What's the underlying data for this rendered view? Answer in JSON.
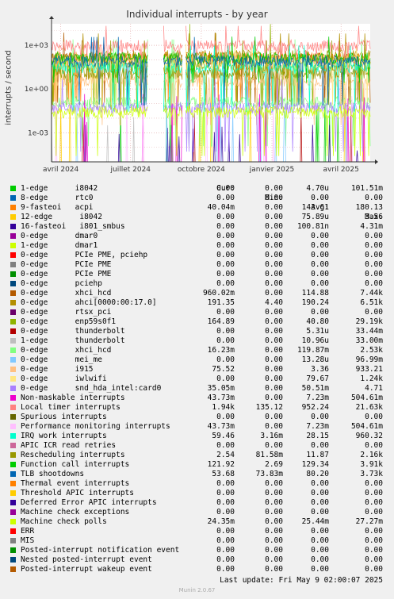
{
  "title": "Individual interrupts - by year",
  "vendor": "RRDTOOL / TOBI OETIKER",
  "footer": {
    "last_update": "Last update: Fri May  9 02:00:07 2025",
    "munin": "Munin 2.0.67"
  },
  "columns": [
    "Cur:",
    "Min:",
    "Avg:",
    "Max:"
  ],
  "chart_data": {
    "type": "line",
    "title": "Individual interrupts - by year",
    "ylabel": "interrupts / second",
    "yscale": "log",
    "ylim": [
      1e-05,
      30000
    ],
    "y_ticks": [
      0.001,
      1,
      1000
    ],
    "y_tick_labels": [
      "1e-03",
      "1e+00",
      "1e+03"
    ],
    "xlim": [
      "2024-03-20",
      "2025-05-09"
    ],
    "x_ticks": [
      "2024-04-01",
      "2024-07-01",
      "2024-10-01",
      "2025-01-01",
      "2025-04-01"
    ],
    "x_tick_labels": [
      "avril 2024",
      "juillet 2024",
      "octobre 2024",
      "janvier 2025",
      "avril 2025"
    ],
    "data_gaps": [
      [
        "2024-07-24",
        "2024-08-12"
      ],
      [
        "2024-09-07",
        "2024-09-10"
      ]
    ],
    "grid": true,
    "series": [
      {
        "name": "1-edge      i8042",
        "color": "#00cc00",
        "cur": "0.00",
        "min": "0.00",
        "avg": "4.70u",
        "max": "101.51m"
      },
      {
        "name": "8-edge      rtc0",
        "color": "#0066b3",
        "cur": "0.00",
        "min": "0.00",
        "avg": "0.00",
        "max": "0.00"
      },
      {
        "name": "9-fasteoi   acpi",
        "color": "#ff8000",
        "cur": "40.04m",
        "min": "0.00",
        "avg": "143.61",
        "max": "180.13"
      },
      {
        "name": "12-edge      i8042",
        "color": "#ffcc00",
        "cur": "0.00",
        "min": "0.00",
        "avg": "75.89u",
        "max": "3.56"
      },
      {
        "name": "16-fasteoi   i801_smbus",
        "color": "#330099",
        "cur": "0.00",
        "min": "0.00",
        "avg": "100.81n",
        "max": "4.31m"
      },
      {
        "name": "0-edge      dmar0",
        "color": "#990099",
        "cur": "0.00",
        "min": "0.00",
        "avg": "0.00",
        "max": "0.00"
      },
      {
        "name": "1-edge      dmar1",
        "color": "#ccff00",
        "cur": "0.00",
        "min": "0.00",
        "avg": "0.00",
        "max": "0.00"
      },
      {
        "name": "0-edge      PCIe PME, pciehp",
        "color": "#ff0000",
        "cur": "0.00",
        "min": "0.00",
        "avg": "0.00",
        "max": "0.00"
      },
      {
        "name": "0-edge      PCIe PME",
        "color": "#808080",
        "cur": "0.00",
        "min": "0.00",
        "avg": "0.00",
        "max": "0.00"
      },
      {
        "name": "0-edge      PCIe PME",
        "color": "#008f00",
        "cur": "0.00",
        "min": "0.00",
        "avg": "0.00",
        "max": "0.00"
      },
      {
        "name": "0-edge      pciehp",
        "color": "#00487d",
        "cur": "0.00",
        "min": "0.00",
        "avg": "0.00",
        "max": "0.00"
      },
      {
        "name": "0-edge      xhci_hcd",
        "color": "#b35a00",
        "cur": "960.02m",
        "min": "0.00",
        "avg": "114.88",
        "max": "7.44k"
      },
      {
        "name": "0-edge      ahci[0000:00:17.0]",
        "color": "#b38f00",
        "cur": "191.35",
        "min": "4.40",
        "avg": "190.24",
        "max": "6.51k"
      },
      {
        "name": "0-edge      rtsx_pci",
        "color": "#6b006b",
        "cur": "0.00",
        "min": "0.00",
        "avg": "0.00",
        "max": "0.00"
      },
      {
        "name": "0-edge      enp59s0f1",
        "color": "#8fb300",
        "cur": "164.89",
        "min": "0.00",
        "avg": "40.80",
        "max": "29.19k"
      },
      {
        "name": "0-edge      thunderbolt",
        "color": "#b30000",
        "cur": "0.00",
        "min": "0.00",
        "avg": "5.31u",
        "max": "33.44m"
      },
      {
        "name": "1-edge      thunderbolt",
        "color": "#bebebe",
        "cur": "0.00",
        "min": "0.00",
        "avg": "10.96u",
        "max": "33.00m"
      },
      {
        "name": "0-edge      xhci_hcd",
        "color": "#80ff80",
        "cur": "16.23m",
        "min": "0.00",
        "avg": "119.87m",
        "max": "2.53k"
      },
      {
        "name": "0-edge      mei_me",
        "color": "#80c9ff",
        "cur": "0.00",
        "min": "0.00",
        "avg": "13.28u",
        "max": "96.99m"
      },
      {
        "name": "0-edge      i915",
        "color": "#ffc080",
        "cur": "75.52",
        "min": "0.00",
        "avg": "3.36",
        "max": "933.21"
      },
      {
        "name": "0-edge      iwlwifi",
        "color": "#ffe680",
        "cur": "0.00",
        "min": "0.00",
        "avg": "79.67",
        "max": "1.24k"
      },
      {
        "name": "0-edge      snd_hda_intel:card0",
        "color": "#aa80ff",
        "cur": "35.05m",
        "min": "0.00",
        "avg": "50.51m",
        "max": "4.71"
      },
      {
        "name": "Non-maskable interrupts",
        "color": "#ee00cc",
        "cur": "43.73m",
        "min": "0.00",
        "avg": "7.23m",
        "max": "504.61m"
      },
      {
        "name": "Local timer interrupts",
        "color": "#ff8080",
        "cur": "1.94k",
        "min": "135.12",
        "avg": "952.24",
        "max": "21.63k"
      },
      {
        "name": "Spurious interrupts",
        "color": "#666600",
        "cur": "0.00",
        "min": "0.00",
        "avg": "0.00",
        "max": "0.00"
      },
      {
        "name": "Performance monitoring interrupts",
        "color": "#ffbfff",
        "cur": "43.73m",
        "min": "0.00",
        "avg": "7.23m",
        "max": "504.61m"
      },
      {
        "name": "IRQ work interrupts",
        "color": "#00ffcc",
        "cur": "59.46",
        "min": "3.16m",
        "avg": "28.15",
        "max": "960.32"
      },
      {
        "name": "APIC ICR read retries",
        "color": "#cc6699",
        "cur": "0.00",
        "min": "0.00",
        "avg": "0.00",
        "max": "0.00"
      },
      {
        "name": "Rescheduling interrupts",
        "color": "#999900",
        "cur": "2.54",
        "min": "81.58m",
        "avg": "11.87",
        "max": "2.16k"
      },
      {
        "name": "Function call interrupts",
        "color": "#00cc00",
        "cur": "121.92",
        "min": "2.69",
        "avg": "129.34",
        "max": "3.91k"
      },
      {
        "name": "TLB shootdowns",
        "color": "#0066b3",
        "cur": "53.68",
        "min": "73.83m",
        "avg": "80.20",
        "max": "3.73k"
      },
      {
        "name": "Thermal event interrupts",
        "color": "#ff8000",
        "cur": "0.00",
        "min": "0.00",
        "avg": "0.00",
        "max": "0.00"
      },
      {
        "name": "Threshold APIC interrupts",
        "color": "#ffcc00",
        "cur": "0.00",
        "min": "0.00",
        "avg": "0.00",
        "max": "0.00"
      },
      {
        "name": "Deferred Error APIC interrupts",
        "color": "#330099",
        "cur": "0.00",
        "min": "0.00",
        "avg": "0.00",
        "max": "0.00"
      },
      {
        "name": "Machine check exceptions",
        "color": "#990099",
        "cur": "0.00",
        "min": "0.00",
        "avg": "0.00",
        "max": "0.00"
      },
      {
        "name": "Machine check polls",
        "color": "#ccff00",
        "cur": "24.35m",
        "min": "0.00",
        "avg": "25.44m",
        "max": "27.27m"
      },
      {
        "name": "ERR",
        "color": "#ff0000",
        "cur": "0.00",
        "min": "0.00",
        "avg": "0.00",
        "max": "0.00"
      },
      {
        "name": "MIS",
        "color": "#808080",
        "cur": "0.00",
        "min": "0.00",
        "avg": "0.00",
        "max": "0.00"
      },
      {
        "name": "Posted-interrupt notification event",
        "color": "#008f00",
        "cur": "0.00",
        "min": "0.00",
        "avg": "0.00",
        "max": "0.00"
      },
      {
        "name": "Nested posted-interrupt event",
        "color": "#00487d",
        "cur": "0.00",
        "min": "0.00",
        "avg": "0.00",
        "max": "0.00"
      },
      {
        "name": "Posted-interrupt wakeup event",
        "color": "#b35a00",
        "cur": "0.00",
        "min": "0.00",
        "avg": "0.00",
        "max": "0.00"
      }
    ]
  }
}
